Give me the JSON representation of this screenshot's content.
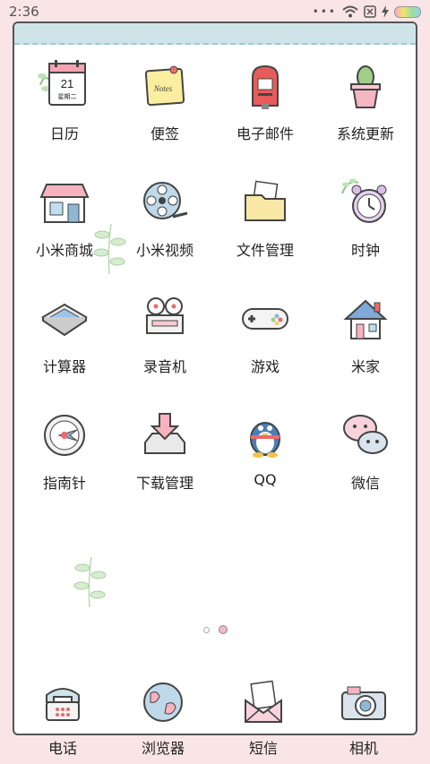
{
  "status_bar": {
    "time": "2:36"
  },
  "apps": [
    {
      "label": "日历",
      "icon": "calendar-icon",
      "calendar_day": "21",
      "calendar_weekday": "星期二"
    },
    {
      "label": "便签",
      "icon": "notes-icon",
      "note_text": "Notes"
    },
    {
      "label": "电子邮件",
      "icon": "mailbox-icon"
    },
    {
      "label": "系统更新",
      "icon": "cactus-icon"
    },
    {
      "label": "小米商城",
      "icon": "shop-icon"
    },
    {
      "label": "小米视频",
      "icon": "film-reel-icon"
    },
    {
      "label": "文件管理",
      "icon": "folder-icon"
    },
    {
      "label": "时钟",
      "icon": "alarm-clock-icon"
    },
    {
      "label": "计算器",
      "icon": "calculator-icon"
    },
    {
      "label": "录音机",
      "icon": "tape-recorder-icon"
    },
    {
      "label": "游戏",
      "icon": "gamepad-icon"
    },
    {
      "label": "米家",
      "icon": "house-icon"
    },
    {
      "label": "指南针",
      "icon": "compass-icon"
    },
    {
      "label": "下载管理",
      "icon": "download-tray-icon"
    },
    {
      "label": "QQ",
      "icon": "penguin-icon"
    },
    {
      "label": "微信",
      "icon": "chat-bubbles-icon"
    }
  ],
  "dock": [
    {
      "label": "电话",
      "icon": "telephone-icon"
    },
    {
      "label": "浏览器",
      "icon": "globe-icon"
    },
    {
      "label": "短信",
      "icon": "envelope-icon"
    },
    {
      "label": "相机",
      "icon": "camera-icon"
    }
  ],
  "pager": {
    "pages": 2,
    "current": 2
  },
  "colors": {
    "background": "#f9e4e6",
    "card_header": "#cfe4e8",
    "accent_pink": "#f5b7c9"
  }
}
